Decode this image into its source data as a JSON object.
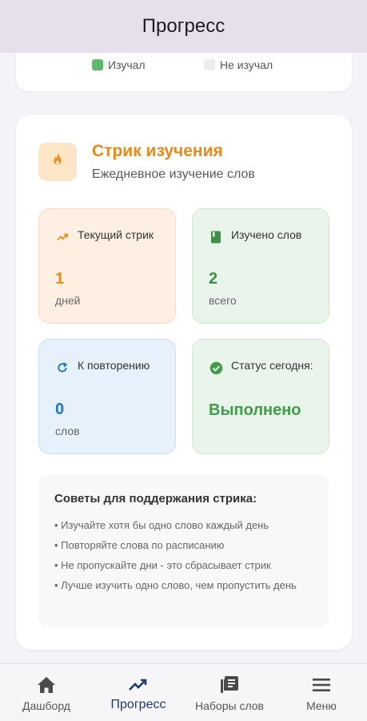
{
  "appbar": {
    "title": "Прогресс"
  },
  "legend": {
    "studied": {
      "label": "Изучал",
      "color": "#5fb96a"
    },
    "not_studied": {
      "label": "Не изучал",
      "color": "#ececec"
    }
  },
  "streak": {
    "title": "Стрик изучения",
    "subtitle": "Ежедневное изучение слов",
    "title_color": "#e8891a",
    "icon": "fire-icon",
    "stats": {
      "current": {
        "label": "Текущий стрик",
        "value": "1",
        "unit": "дней",
        "icon": "trending-up-icon"
      },
      "learned": {
        "label": "Изучено слов",
        "value": "2",
        "unit": "всего",
        "icon": "book-icon"
      },
      "review": {
        "label": "К повторению",
        "value": "0",
        "unit": "слов",
        "icon": "refresh-icon"
      },
      "status": {
        "label": "Статус сегодня:",
        "value": "Выполнено",
        "icon": "check-circle-icon"
      }
    },
    "tips": {
      "title": "Советы для поддержания стрика:",
      "items": [
        "• Изучайте хотя бы одно слово каждый день",
        "• Повторяйте слова по расписанию",
        "• Не пропускайте дни - это сбрасывает стрик",
        "• Лучше изучить одно слово, чем пропустить день"
      ]
    }
  },
  "nav": {
    "items": [
      {
        "label": "Дашборд",
        "icon": "home-icon"
      },
      {
        "label": "Прогресс",
        "icon": "trending-up-icon",
        "active": true
      },
      {
        "label": "Наборы слов",
        "icon": "library-icon"
      },
      {
        "label": "Меню",
        "icon": "menu-icon"
      }
    ]
  }
}
